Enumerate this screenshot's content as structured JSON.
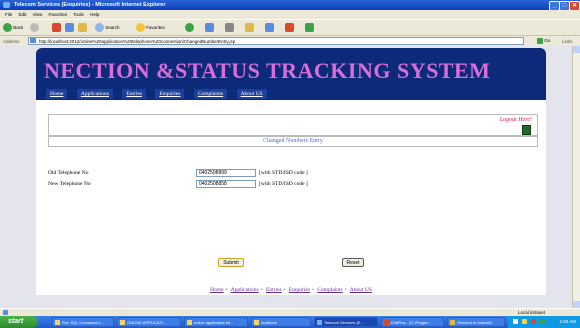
{
  "window": {
    "title": "Telecom Services (Enquiries) - Microsoft Internet Explorer",
    "min": "_",
    "max": "□",
    "close": "✕"
  },
  "menu": [
    "File",
    "Edit",
    "View",
    "Favorites",
    "Tools",
    "Help"
  ],
  "toolbar": {
    "back": "Back",
    "search": "Search",
    "favorites": "Favorites"
  },
  "address": {
    "label": "Address",
    "url": "http://localhost:2012/online%20application%20telephone%20connection/ChangedNumberEntry.jsp",
    "go": "Go",
    "links": "Links"
  },
  "page": {
    "banner_title": "NECTION &STATUS TRACKING SYSTEM",
    "nav": [
      "Home",
      "Applications",
      "Entries",
      "Enquiries",
      "Complaints",
      "About US"
    ],
    "logout": "Logout Here!",
    "subtitle": "Changed Numbers Entry",
    "old_label": "Old Telephone No",
    "old_value": "0402508899",
    "new_label": "New Telephone No",
    "new_value": "0402508858",
    "hint": "[with STD/ISD code ]",
    "submit": "Submit",
    "reset": "Reset",
    "footer": [
      "Home",
      "Applications",
      "Entries",
      "Enquiries",
      "Complaints",
      "About US"
    ]
  },
  "status": {
    "zone": "Local intranet"
  },
  "taskbar": {
    "start": "start",
    "tasks": [
      "Run SQL Command L...",
      "ONLINE APPLICATI...",
      "online application tel...",
      "localhost",
      "Telecom Services (E...",
      "EditPlus - [C:\\Progra...",
      "Shortcut to tomcat6"
    ],
    "clock": "1:55 AM"
  }
}
